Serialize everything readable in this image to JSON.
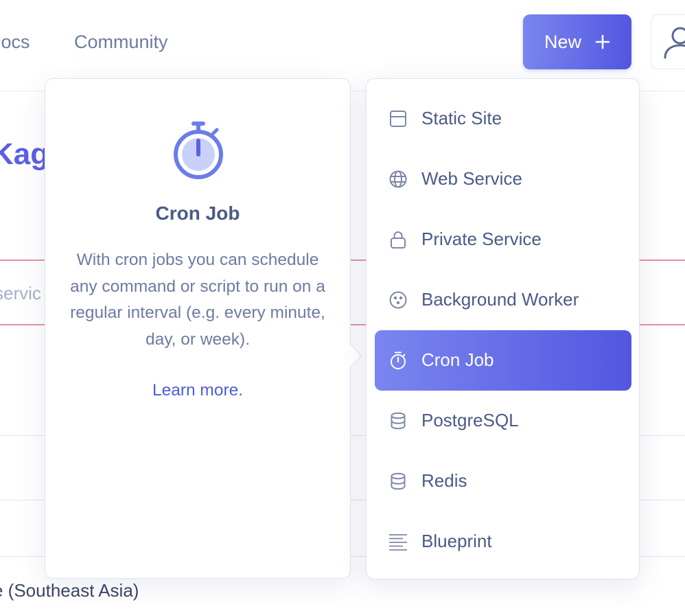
{
  "topnav": {
    "docs_label": "Docs",
    "community_label": "Community",
    "new_button_label": "New",
    "new_button_icon": "plus-icon",
    "avatar_icon": "user-icon"
  },
  "background": {
    "heading_fragment": "Kag",
    "search_placeholder_fragment": "servic",
    "region_fragment": "e (Southeast Asia)"
  },
  "info_panel": {
    "icon": "stopwatch-icon",
    "title": "Cron Job",
    "description": "With cron jobs you can schedule any command or script to run on a regular interval (e.g. every minute, day, or week).",
    "link_label": "Learn more."
  },
  "menu": {
    "items": [
      {
        "label": "Static Site",
        "icon": "static-site-icon"
      },
      {
        "label": "Web Service",
        "icon": "globe-icon"
      },
      {
        "label": "Private Service",
        "icon": "lock-icon"
      },
      {
        "label": "Background Worker",
        "icon": "background-worker-icon"
      },
      {
        "label": "Cron Job",
        "icon": "stopwatch-icon",
        "active": true
      },
      {
        "label": "PostgreSQL",
        "icon": "database-icon"
      },
      {
        "label": "Redis",
        "icon": "database-icon"
      },
      {
        "label": "Blueprint",
        "icon": "blueprint-lines-icon"
      }
    ]
  },
  "colors": {
    "accent_start": "#7a86f0",
    "accent_end": "#5356e0",
    "text": "#4b5a86",
    "muted_text": "#6d7ba3",
    "link": "#4f5bdc",
    "error_line": "#ec8ea0"
  }
}
